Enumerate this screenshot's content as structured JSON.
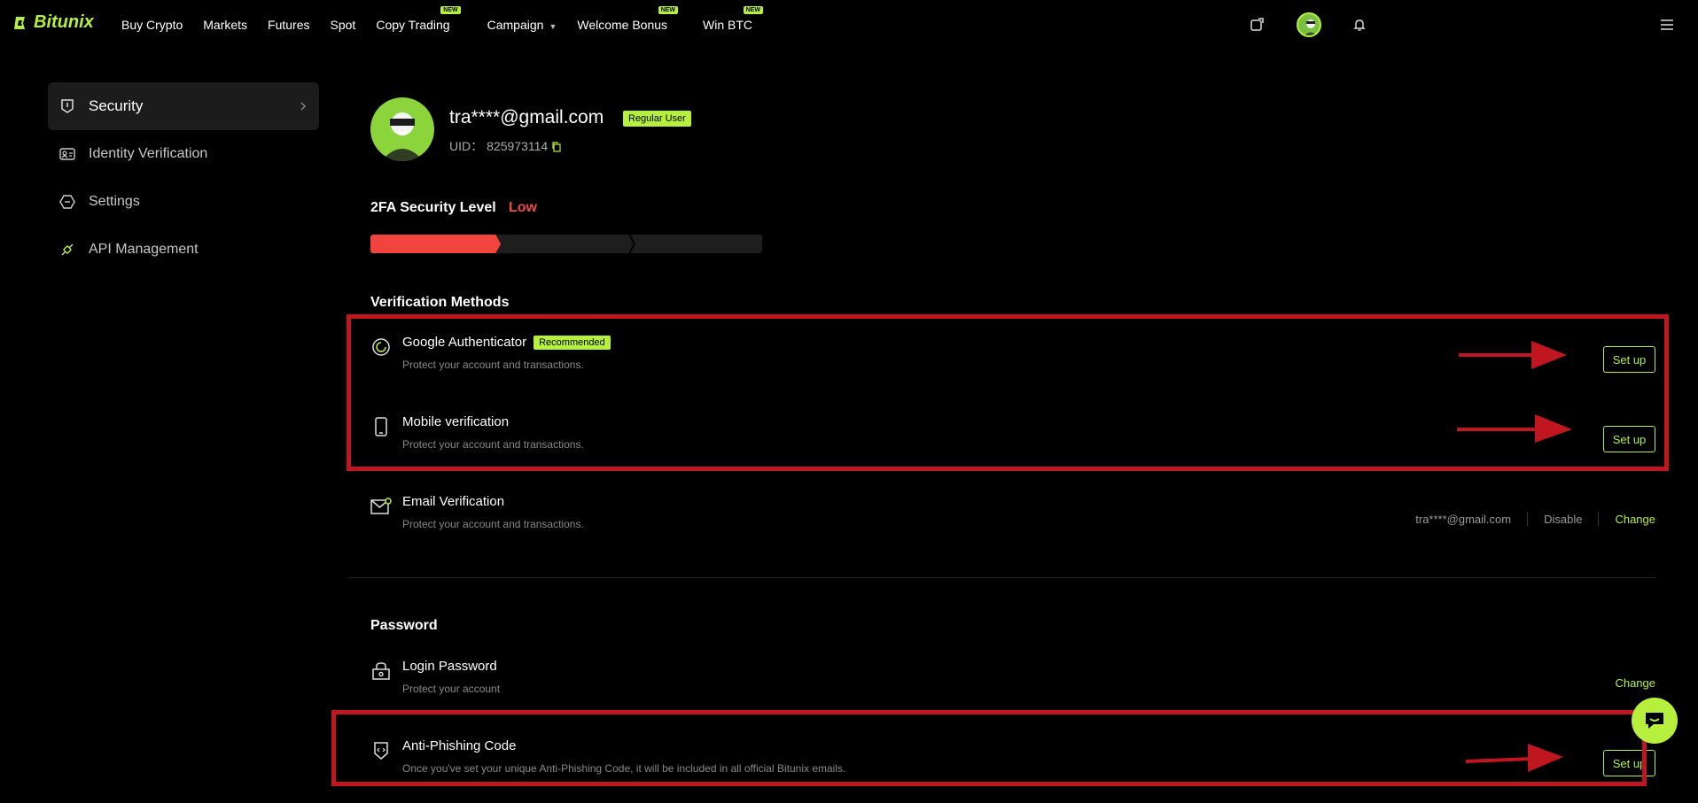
{
  "brand": {
    "name": "Bitunix",
    "accent": "#b6f03c",
    "danger": "#f0443c"
  },
  "nav": {
    "items": [
      {
        "label": "Buy Crypto"
      },
      {
        "label": "Markets"
      },
      {
        "label": "Futures"
      },
      {
        "label": "Spot"
      },
      {
        "label": "Copy Trading",
        "tag": "NEW"
      },
      {
        "label": "Campaign"
      },
      {
        "label": "Welcome Bonus",
        "tag": "NEW"
      },
      {
        "label": "Win BTC",
        "tag": "NEW"
      }
    ]
  },
  "sidebar": {
    "items": [
      {
        "label": "Security",
        "icon": "shield-icon",
        "active": true
      },
      {
        "label": "Identity Verification",
        "icon": "id-card-icon"
      },
      {
        "label": "Settings",
        "icon": "settings-icon"
      },
      {
        "label": "API Management",
        "icon": "api-icon"
      }
    ]
  },
  "profile": {
    "email": "tra****@gmail.com",
    "badge": "Regular User",
    "uid_label": "UID：",
    "uid": "825973114"
  },
  "security": {
    "title": "2FA Security Level",
    "level": "Low",
    "progress_fraction": 0.333
  },
  "verification": {
    "title": "Verification Methods",
    "google": {
      "title": "Google Authenticator",
      "badge": "Recommended",
      "desc": "Protect your account and transactions.",
      "action": "Set up"
    },
    "mobile": {
      "title": "Mobile verification",
      "desc": "Protect your account and transactions.",
      "action": "Set up"
    },
    "email": {
      "title": "Email Verification",
      "desc": "Protect your account and transactions.",
      "value": "tra****@gmail.com",
      "disable": "Disable",
      "change": "Change"
    }
  },
  "password": {
    "title": "Password",
    "login": {
      "title": "Login Password",
      "desc": "Protect your account",
      "action": "Change"
    },
    "antiphishing": {
      "title": "Anti-Phishing Code",
      "desc": "Once you've set your unique Anti-Phishing Code, it will be included in all official Bitunix emails.",
      "action": "Set up"
    }
  }
}
